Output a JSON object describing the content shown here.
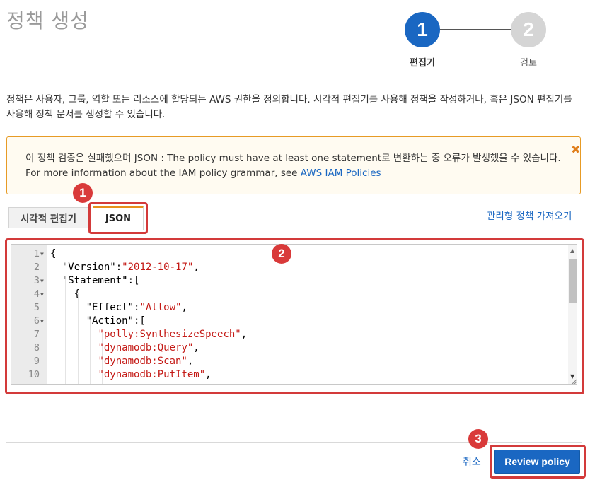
{
  "page": {
    "title": "정책 생성",
    "description": "정책은 사용자, 그룹, 역할 또는 리소스에 할당되는 AWS 권한을 정의합니다. 시각적 편집기를 사용해 정책을 작성하거나, 혹은 JSON 편집기를 사용해 정책 문서를 생성할 수 있습니다."
  },
  "stepper": {
    "steps": [
      {
        "number": "1",
        "label": "편집기",
        "active": true
      },
      {
        "number": "2",
        "label": "검토",
        "active": false
      }
    ]
  },
  "alert": {
    "message": "이 정책 검증은 실패했으며 JSON : The policy must have at least one statement로 변환하는 중 오류가 발생했을 수 있습니다. For more information about the IAM policy grammar, see ",
    "link_text": "AWS IAM Policies",
    "close_icon": "close-icon",
    "border_color": "#e79b25"
  },
  "tabs": {
    "visual_editor": "시각적 편집기",
    "json": "JSON",
    "selected": "JSON",
    "import_link": "관리형 정책 가져오기"
  },
  "editor": {
    "lines": [
      {
        "num": "1",
        "fold": true,
        "parts": [
          {
            "t": "{",
            "c": "p"
          }
        ]
      },
      {
        "num": "2",
        "fold": false,
        "parts": [
          {
            "t": "  \"Version\":",
            "c": "p"
          },
          {
            "t": "\"2012-10-17\"",
            "c": "s"
          },
          {
            "t": ",",
            "c": "p"
          }
        ]
      },
      {
        "num": "3",
        "fold": true,
        "parts": [
          {
            "t": "  \"Statement\":[",
            "c": "p"
          }
        ]
      },
      {
        "num": "4",
        "fold": true,
        "parts": [
          {
            "t": "    {",
            "c": "p"
          }
        ]
      },
      {
        "num": "5",
        "fold": false,
        "parts": [
          {
            "t": "      \"Effect\":",
            "c": "p"
          },
          {
            "t": "\"Allow\"",
            "c": "s"
          },
          {
            "t": ",",
            "c": "p"
          }
        ]
      },
      {
        "num": "6",
        "fold": true,
        "parts": [
          {
            "t": "      \"Action\":[",
            "c": "p"
          }
        ]
      },
      {
        "num": "7",
        "fold": false,
        "parts": [
          {
            "t": "        ",
            "c": "p"
          },
          {
            "t": "\"polly:SynthesizeSpeech\"",
            "c": "s"
          },
          {
            "t": ",",
            "c": "p"
          }
        ]
      },
      {
        "num": "8",
        "fold": false,
        "parts": [
          {
            "t": "        ",
            "c": "p"
          },
          {
            "t": "\"dynamodb:Query\"",
            "c": "s"
          },
          {
            "t": ",",
            "c": "p"
          }
        ]
      },
      {
        "num": "9",
        "fold": false,
        "parts": [
          {
            "t": "        ",
            "c": "p"
          },
          {
            "t": "\"dynamodb:Scan\"",
            "c": "s"
          },
          {
            "t": ",",
            "c": "p"
          }
        ]
      },
      {
        "num": "10",
        "fold": false,
        "parts": [
          {
            "t": "        ",
            "c": "p"
          },
          {
            "t": "\"dynamodb:PutItem\"",
            "c": "s"
          },
          {
            "t": ",",
            "c": "p"
          }
        ]
      }
    ]
  },
  "annotations": {
    "badge_1": "1",
    "badge_2": "2",
    "badge_3": "3",
    "highlight_color": "#d33a3a"
  },
  "footer": {
    "cancel_label": "취소",
    "review_label": "Review policy"
  },
  "colors": {
    "primary": "#1a67c2",
    "string": "#c41a16"
  }
}
